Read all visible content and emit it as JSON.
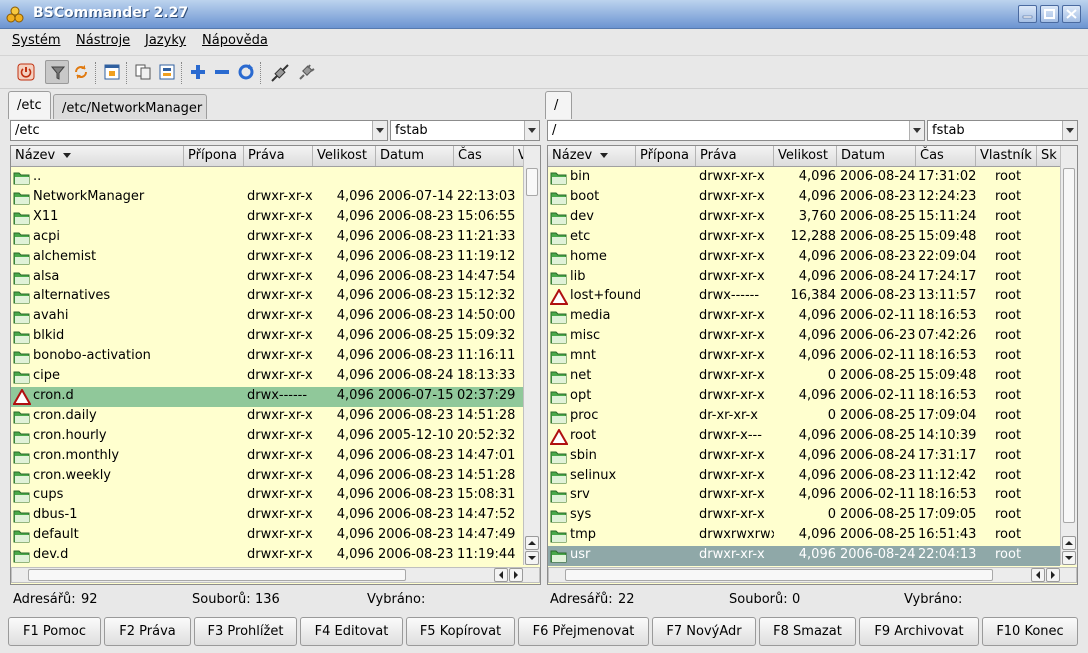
{
  "window": {
    "title": "BSCommander 2.27"
  },
  "menu": [
    "Systém",
    "Nástroje",
    "Jazyky",
    "Nápověda"
  ],
  "toolbar": {
    "icons": [
      "power-icon",
      "filter-icon",
      "sync-icon",
      "tree-icon",
      "copy-icon",
      "compare-icon",
      "add-icon",
      "remove-icon",
      "refresh-icon",
      "connect-icon",
      "disconnect-icon"
    ]
  },
  "left": {
    "tabs": [
      "/etc",
      "/etc/NetworkManager"
    ],
    "path": "/etc",
    "filter": "fstab",
    "columns": [
      "Název",
      "Přípona",
      "Práva",
      "Velikost",
      "Datum",
      "Čas"
    ],
    "rows": [
      {
        "name": "..",
        "perm": "",
        "size": "",
        "date": "",
        "time": ""
      },
      {
        "name": "NetworkManager",
        "perm": "drwxr-xr-x",
        "size": "4,096",
        "date": "2006-07-14",
        "time": "22:13:03"
      },
      {
        "name": "X11",
        "perm": "drwxr-xr-x",
        "size": "4,096",
        "date": "2006-08-23",
        "time": "15:06:55"
      },
      {
        "name": "acpi",
        "perm": "drwxr-xr-x",
        "size": "4,096",
        "date": "2006-08-23",
        "time": "11:21:33"
      },
      {
        "name": "alchemist",
        "perm": "drwxr-xr-x",
        "size": "4,096",
        "date": "2006-08-23",
        "time": "11:19:12"
      },
      {
        "name": "alsa",
        "perm": "drwxr-xr-x",
        "size": "4,096",
        "date": "2006-08-23",
        "time": "14:47:54"
      },
      {
        "name": "alternatives",
        "perm": "drwxr-xr-x",
        "size": "4,096",
        "date": "2006-08-23",
        "time": "15:12:32"
      },
      {
        "name": "avahi",
        "perm": "drwxr-xr-x",
        "size": "4,096",
        "date": "2006-08-23",
        "time": "14:50:00"
      },
      {
        "name": "blkid",
        "perm": "drwxr-xr-x",
        "size": "4,096",
        "date": "2006-08-25",
        "time": "15:09:32"
      },
      {
        "name": "bonobo-activation",
        "perm": "drwxr-xr-x",
        "size": "4,096",
        "date": "2006-08-23",
        "time": "11:16:11"
      },
      {
        "name": "cipe",
        "perm": "drwxr-xr-x",
        "size": "4,096",
        "date": "2006-08-24",
        "time": "18:13:33"
      },
      {
        "name": "cron.d",
        "perm": "drwx------",
        "size": "4,096",
        "date": "2006-07-15",
        "time": "02:37:29",
        "warn": true,
        "sel": true
      },
      {
        "name": "cron.daily",
        "perm": "drwxr-xr-x",
        "size": "4,096",
        "date": "2006-08-23",
        "time": "14:51:28"
      },
      {
        "name": "cron.hourly",
        "perm": "drwxr-xr-x",
        "size": "4,096",
        "date": "2005-12-10",
        "time": "20:52:32"
      },
      {
        "name": "cron.monthly",
        "perm": "drwxr-xr-x",
        "size": "4,096",
        "date": "2006-08-23",
        "time": "14:47:01"
      },
      {
        "name": "cron.weekly",
        "perm": "drwxr-xr-x",
        "size": "4,096",
        "date": "2006-08-23",
        "time": "14:51:28"
      },
      {
        "name": "cups",
        "perm": "drwxr-xr-x",
        "size": "4,096",
        "date": "2006-08-23",
        "time": "15:08:31"
      },
      {
        "name": "dbus-1",
        "perm": "drwxr-xr-x",
        "size": "4,096",
        "date": "2006-08-23",
        "time": "14:47:52"
      },
      {
        "name": "default",
        "perm": "drwxr-xr-x",
        "size": "4,096",
        "date": "2006-08-23",
        "time": "14:47:49"
      },
      {
        "name": "dev.d",
        "perm": "drwxr-xr-x",
        "size": "4,096",
        "date": "2006-08-23",
        "time": "11:19:44"
      }
    ],
    "status": {
      "dirs_label": "Adresářů:",
      "dirs": "92",
      "files_label": "Souborů:",
      "files": "136",
      "selected_label": "Vybráno:"
    }
  },
  "right": {
    "tabs": [
      "/"
    ],
    "path": "/",
    "filter": "fstab",
    "columns": [
      "Název",
      "Přípona",
      "Práva",
      "Velikost",
      "Datum",
      "Čas",
      "Vlastník",
      "Sk"
    ],
    "rows": [
      {
        "name": "bin",
        "perm": "drwxr-xr-x",
        "size": "4,096",
        "date": "2006-08-24",
        "time": "17:31:02",
        "owner": "root"
      },
      {
        "name": "boot",
        "perm": "drwxr-xr-x",
        "size": "4,096",
        "date": "2006-08-23",
        "time": "12:24:23",
        "owner": "root"
      },
      {
        "name": "dev",
        "perm": "drwxr-xr-x",
        "size": "3,760",
        "date": "2006-08-25",
        "time": "15:11:24",
        "owner": "root"
      },
      {
        "name": "etc",
        "perm": "drwxr-xr-x",
        "size": "12,288",
        "date": "2006-08-25",
        "time": "15:09:48",
        "owner": "root"
      },
      {
        "name": "home",
        "perm": "drwxr-xr-x",
        "size": "4,096",
        "date": "2006-08-23",
        "time": "22:09:04",
        "owner": "root"
      },
      {
        "name": "lib",
        "perm": "drwxr-xr-x",
        "size": "4,096",
        "date": "2006-08-24",
        "time": "17:24:17",
        "owner": "root"
      },
      {
        "name": "lost+found",
        "perm": "drwx------",
        "size": "16,384",
        "date": "2006-08-23",
        "time": "13:11:57",
        "owner": "root",
        "warn": true
      },
      {
        "name": "media",
        "perm": "drwxr-xr-x",
        "size": "4,096",
        "date": "2006-02-11",
        "time": "18:16:53",
        "owner": "root"
      },
      {
        "name": "misc",
        "perm": "drwxr-xr-x",
        "size": "4,096",
        "date": "2006-06-23",
        "time": "07:42:26",
        "owner": "root"
      },
      {
        "name": "mnt",
        "perm": "drwxr-xr-x",
        "size": "4,096",
        "date": "2006-02-11",
        "time": "18:16:53",
        "owner": "root"
      },
      {
        "name": "net",
        "perm": "drwxr-xr-x",
        "size": "0",
        "date": "2006-08-25",
        "time": "15:09:48",
        "owner": "root"
      },
      {
        "name": "opt",
        "perm": "drwxr-xr-x",
        "size": "4,096",
        "date": "2006-02-11",
        "time": "18:16:53",
        "owner": "root"
      },
      {
        "name": "proc",
        "perm": "dr-xr-xr-x",
        "size": "0",
        "date": "2006-08-25",
        "time": "17:09:04",
        "owner": "root"
      },
      {
        "name": "root",
        "perm": "drwxr-x---",
        "size": "4,096",
        "date": "2006-08-25",
        "time": "14:10:39",
        "owner": "root",
        "warn": true
      },
      {
        "name": "sbin",
        "perm": "drwxr-xr-x",
        "size": "4,096",
        "date": "2006-08-24",
        "time": "17:31:17",
        "owner": "root"
      },
      {
        "name": "selinux",
        "perm": "drwxr-xr-x",
        "size": "4,096",
        "date": "2006-08-23",
        "time": "11:12:42",
        "owner": "root"
      },
      {
        "name": "srv",
        "perm": "drwxr-xr-x",
        "size": "4,096",
        "date": "2006-02-11",
        "time": "18:16:53",
        "owner": "root"
      },
      {
        "name": "sys",
        "perm": "drwxr-xr-x",
        "size": "0",
        "date": "2006-08-25",
        "time": "17:09:05",
        "owner": "root"
      },
      {
        "name": "tmp",
        "perm": "drwxrwxrwx",
        "size": "4,096",
        "date": "2006-08-25",
        "time": "16:51:43",
        "owner": "root"
      },
      {
        "name": "usr",
        "perm": "drwxr-xr-x",
        "size": "4,096",
        "date": "2006-08-24",
        "time": "22:04:13",
        "owner": "root",
        "sel2": true
      }
    ],
    "status": {
      "dirs_label": "Adresářů:",
      "dirs": "22",
      "files_label": "Souborů:",
      "files": "0",
      "selected_label": "Vybráno:"
    }
  },
  "fkeys": [
    "F1 Pomoc",
    "F2 Práva",
    "F3 Prohlížet",
    "F4 Editovat",
    "F5 Kopírovat",
    "F6 Přejmenovat",
    "F7 NovýAdr",
    "F8 Smazat",
    "F9 Archivovat",
    "F10 Konec"
  ],
  "colors": {
    "list_bg": "#ffffcf",
    "selected_row": "#90c89a",
    "inactive_selected_row": "#8fa8a8",
    "titlebar": "#6c94d1"
  }
}
